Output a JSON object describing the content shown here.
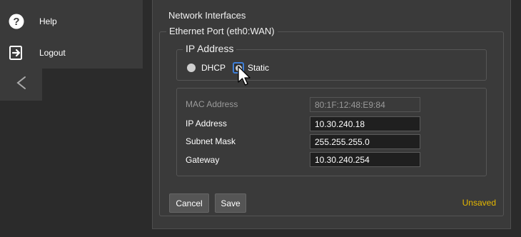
{
  "sidebar": {
    "items": [
      {
        "label": "Help",
        "icon": "question-icon"
      },
      {
        "label": "Logout",
        "icon": "logout-icon"
      }
    ],
    "collapse_icon": "chevron-left-icon"
  },
  "network": {
    "section_title": "Network Interfaces",
    "port_legend": "Ethernet Port (eth0:WAN)",
    "ip_mode": {
      "legend": "IP Address",
      "options": [
        {
          "label": "DHCP",
          "selected": false
        },
        {
          "label": "Static",
          "selected": true
        }
      ]
    },
    "fields": {
      "mac": {
        "label": "MAC Address",
        "value": "80:1F:12:48:E9:84"
      },
      "ip": {
        "label": "IP Address",
        "value": "10.30.240.18"
      },
      "subnet": {
        "label": "Subnet Mask",
        "value": "255.255.255.0"
      },
      "gateway": {
        "label": "Gateway",
        "value": "10.30.240.254"
      }
    }
  },
  "actions": {
    "cancel_label": "Cancel",
    "save_label": "Save",
    "status_text": "Unsaved"
  },
  "colors": {
    "background": "#2b2b2b",
    "panel": "#3a3a3a",
    "focus_ring": "#3f7fd8",
    "status_unsaved": "#e6b800"
  }
}
